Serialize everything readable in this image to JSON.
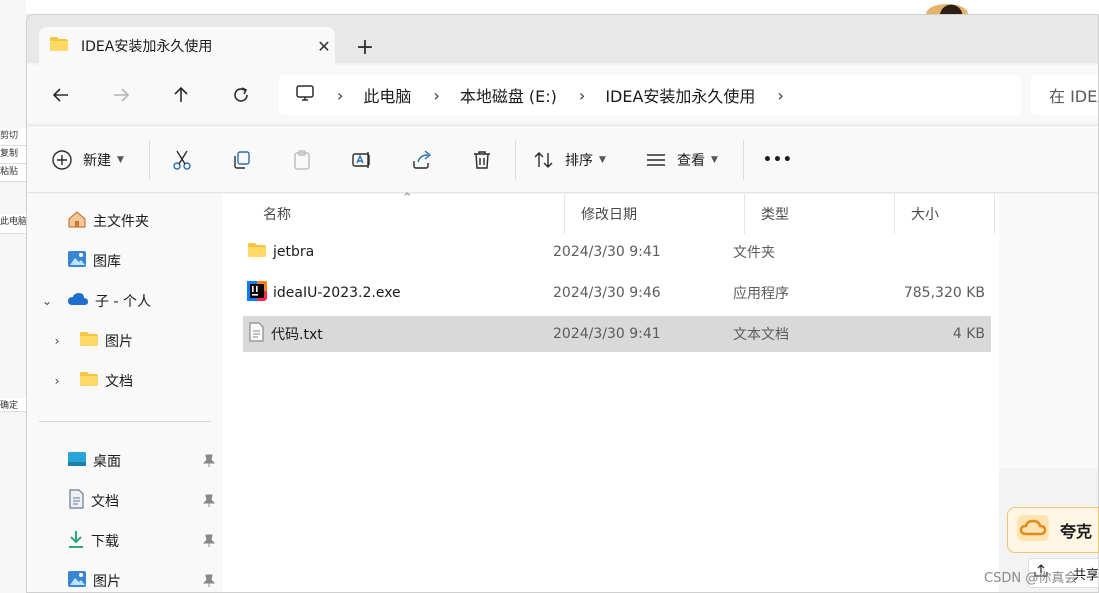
{
  "tab": {
    "title": "IDEA安装加永久使用",
    "close": "✕",
    "new_tab": "+"
  },
  "address": {
    "crumbs": [
      "此电脑",
      "本地磁盘 (E:)",
      "IDEA安装加永久使用"
    ]
  },
  "search": {
    "text": "在 IDEA"
  },
  "toolbar": {
    "new_label": "新建",
    "sort_label": "排序",
    "view_label": "查看",
    "more_label": "•••"
  },
  "sidebar": {
    "items": [
      {
        "label": "主文件夹"
      },
      {
        "label": "图库"
      },
      {
        "label": "子 - 个人"
      },
      {
        "label": "图片"
      },
      {
        "label": "文档"
      }
    ],
    "quick": [
      {
        "label": "桌面"
      },
      {
        "label": "文档"
      },
      {
        "label": "下载"
      },
      {
        "label": "图片"
      }
    ]
  },
  "columns": {
    "name": "名称",
    "modified": "修改日期",
    "type": "类型",
    "size": "大小"
  },
  "files": [
    {
      "name": "jetbra",
      "modified": "2024/3/30 9:41",
      "type": "文件夹",
      "size": ""
    },
    {
      "name": "ideaIU-2023.2.exe",
      "modified": "2024/3/30 9:46",
      "type": "应用程序",
      "size": "785,320 KB"
    },
    {
      "name": "代码.txt",
      "modified": "2024/3/30 9:41",
      "type": "文本文档",
      "size": "4 KB"
    }
  ],
  "overlay": {
    "quark_text": "夸克",
    "share_text": "共享",
    "watermark": "CSDN @你真会"
  },
  "bg_left": [
    "剪切",
    "复制",
    "粘贴",
    "此电脑",
    "确定"
  ],
  "colors": {
    "folder": "#f4c542",
    "accent": "#0067c0",
    "selected_row": "#d9d9d9"
  }
}
